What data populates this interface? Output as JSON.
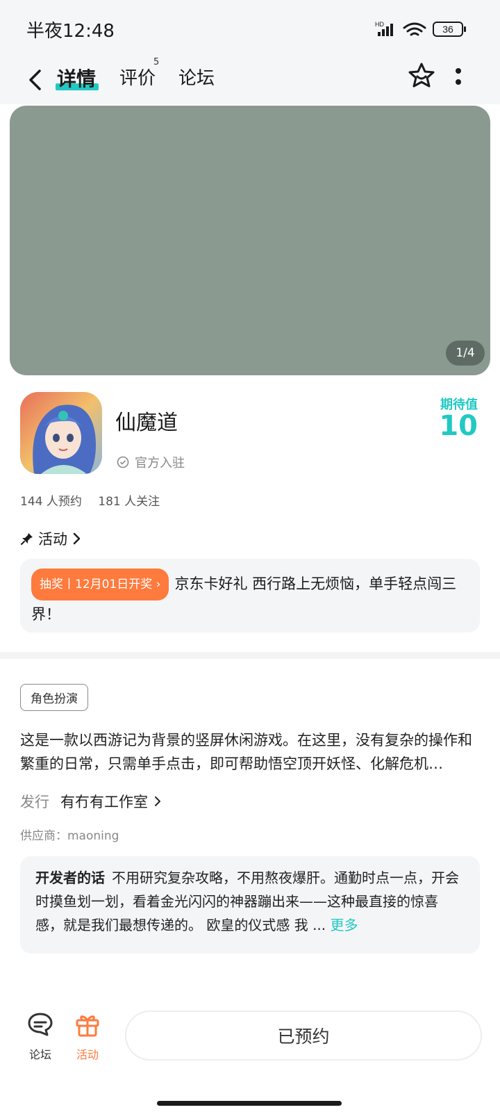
{
  "status_bar": {
    "time": "半夜12:48",
    "hd_label": "HD",
    "battery": "36"
  },
  "navbar": {
    "tabs": [
      {
        "label": "详情"
      },
      {
        "label": "评价",
        "count": "5"
      },
      {
        "label": "论坛"
      }
    ]
  },
  "banner": {
    "counter": "1/4"
  },
  "app": {
    "title": "仙魔道",
    "official_label": "官方入驻",
    "expect_label": "期待值",
    "expect_value": "10",
    "reservations": "144 人预约",
    "followers": "181 人关注"
  },
  "activity": {
    "header": "活动",
    "badge": "抽奖丨12月01日开奖",
    "text": "京东卡好礼 西行路上无烦恼，单手轻点闯三界！"
  },
  "info": {
    "tag": "角色扮演",
    "description": "这是一款以西游记为背景的竖屏休闲游戏。在这里，没有复杂的操作和繁重的日常，只需单手点击，即可帮助悟空顶开妖怪、化解危机…",
    "publisher_label": "发行",
    "publisher_name": "有冇有工作室",
    "supplier": "供应商：maoning"
  },
  "developer": {
    "title": "开发者的话",
    "text": "不用研究复杂攻略，不用熬夜爆肝。通勤时点一点，开会时摸鱼划一划，看着金光闪闪的神器蹦出来——这种最直接的惊喜感，就是我们最想传递的。 欧皇的仪式感 我 ...",
    "more": "更多"
  },
  "bottom_bar": {
    "forum_label": "论坛",
    "activity_label": "活动",
    "reserve_label": "已预约"
  },
  "colors": {
    "accent": "#22c9c3",
    "orange": "#ff7a3d",
    "banner": "#8b9a91"
  }
}
